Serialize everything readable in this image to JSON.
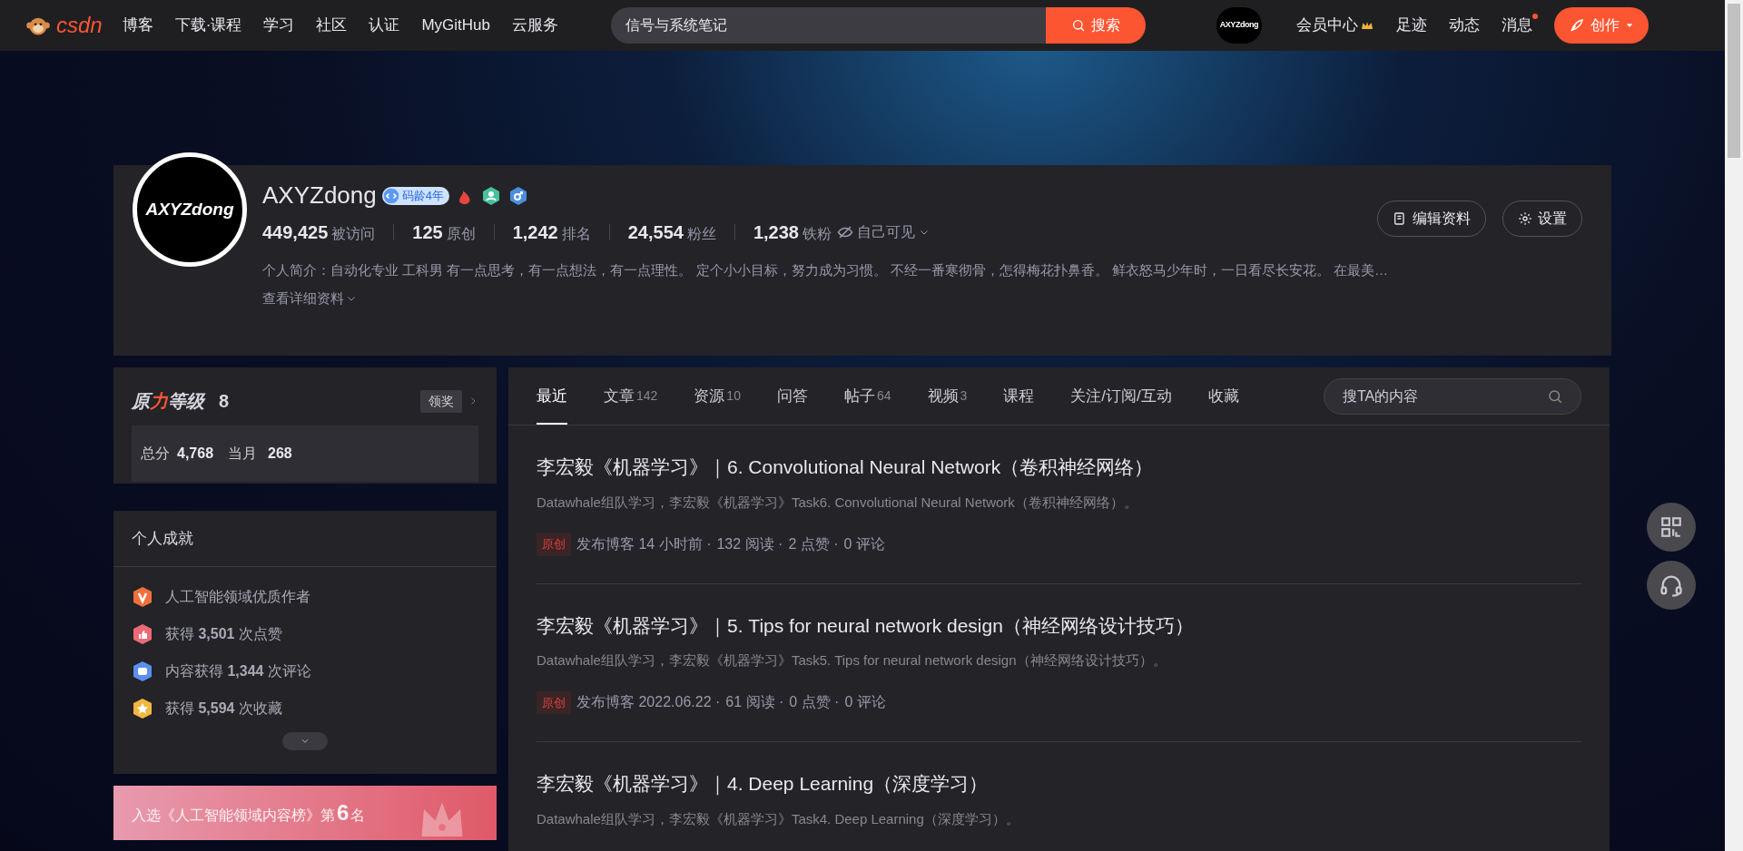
{
  "nav": {
    "logo": "csdn",
    "links": [
      "博客",
      "下载·课程",
      "学习",
      "社区",
      "认证",
      "MyGitHub",
      "云服务"
    ],
    "search": {
      "value": "信号与系统笔记",
      "button": "搜索"
    },
    "avatar_text": "AXYZdong",
    "right_links": [
      {
        "label": "会员中心",
        "kind": "crown"
      },
      {
        "label": "足迹",
        "kind": "plain"
      },
      {
        "label": "动态",
        "kind": "plain"
      },
      {
        "label": "消息",
        "kind": "dot"
      }
    ],
    "create_button": "创作"
  },
  "profile": {
    "avatar_text": "AXYZdong",
    "name": "AXYZdong",
    "badge": "码龄4年",
    "stats": [
      {
        "value": "449,425",
        "label": "被访问"
      },
      {
        "value": "125",
        "label": "原创"
      },
      {
        "value": "1,242",
        "label": "排名"
      },
      {
        "value": "24,554",
        "label": "粉丝"
      },
      {
        "value": "1,238",
        "label": "铁粉"
      }
    ],
    "visibility": "自己可见",
    "bio": "个人简介：自动化专业 工科男 有一点思考，有一点想法，有一点理性。 定个小小目标，努力成为习惯。 不经一番寒彻骨，怎得梅花扑鼻香。 鲜衣怒马少年时，一日看尽长安花。 在最美…",
    "more": "查看详细资料",
    "buttons": [
      {
        "label": "编辑资料",
        "kind": "edit"
      },
      {
        "label": "设置",
        "kind": "gear"
      }
    ]
  },
  "level_card": {
    "title_a": "原",
    "title_b": "力",
    "title_c": "等级",
    "level": "8",
    "award_button": "领奖",
    "total_label": "总分",
    "total": "4,768",
    "month_label": "当月",
    "month": "268"
  },
  "achievements": {
    "title": "个人成就",
    "items": [
      {
        "kind": "v",
        "text": "人工智能领域优质作者"
      },
      {
        "kind": "like",
        "text": "获得 **3,501** 次点赞"
      },
      {
        "kind": "comment",
        "text": "内容获得 **1,344** 次评论"
      },
      {
        "kind": "star",
        "text": "获得 **5,594** 次收藏"
      }
    ]
  },
  "rank_banner": {
    "prefix": "入选《人工智能领域内容榜》第",
    "rank": "6",
    "suffix": "名"
  },
  "tabs": [
    {
      "label": "最近",
      "selected": true
    },
    {
      "label": "文章",
      "count": "142",
      "selected": false
    },
    {
      "label": "资源",
      "count": "10",
      "selected": false
    },
    {
      "label": "问答",
      "selected": false
    },
    {
      "label": "帖子",
      "count": "64",
      "selected": false
    },
    {
      "label": "视频",
      "count": "3",
      "selected": false
    },
    {
      "label": "课程",
      "selected": false
    },
    {
      "label": "关注/订阅/互动",
      "selected": false
    },
    {
      "label": "收藏",
      "selected": false
    }
  ],
  "content_search": {
    "placeholder": "搜TA的内容"
  },
  "articles": [
    {
      "title": "李宏毅《机器学习》｜6. Convolutional Neural Network（卷积神经网络）",
      "summary": "Datawhale组队学习，李宏毅《机器学习》Task6. Convolutional Neural Network（卷积神经网络）。",
      "tag": "原创",
      "meta": [
        "发布博客 14 小时前 ·",
        "132 阅读 ·",
        "2 点赞 ·",
        "0 评论"
      ]
    },
    {
      "title": "李宏毅《机器学习》｜5. Tips for neural network design（神经网络设计技巧）",
      "summary": "Datawhale组队学习，李宏毅《机器学习》Task5. Tips for neural network design（神经网络设计技巧）。",
      "tag": "原创",
      "meta": [
        "发布博客 2022.06.22 ·",
        "61 阅读 ·",
        "0 点赞 ·",
        "0 评论"
      ]
    },
    {
      "title": "李宏毅《机器学习》｜4. Deep Learning（深度学习）",
      "summary": "Datawhale组队学习，李宏毅《机器学习》Task4. Deep Learning（深度学习）。"
    }
  ],
  "float_buttons": [
    {
      "kind": "qr"
    },
    {
      "kind": "headset"
    }
  ]
}
